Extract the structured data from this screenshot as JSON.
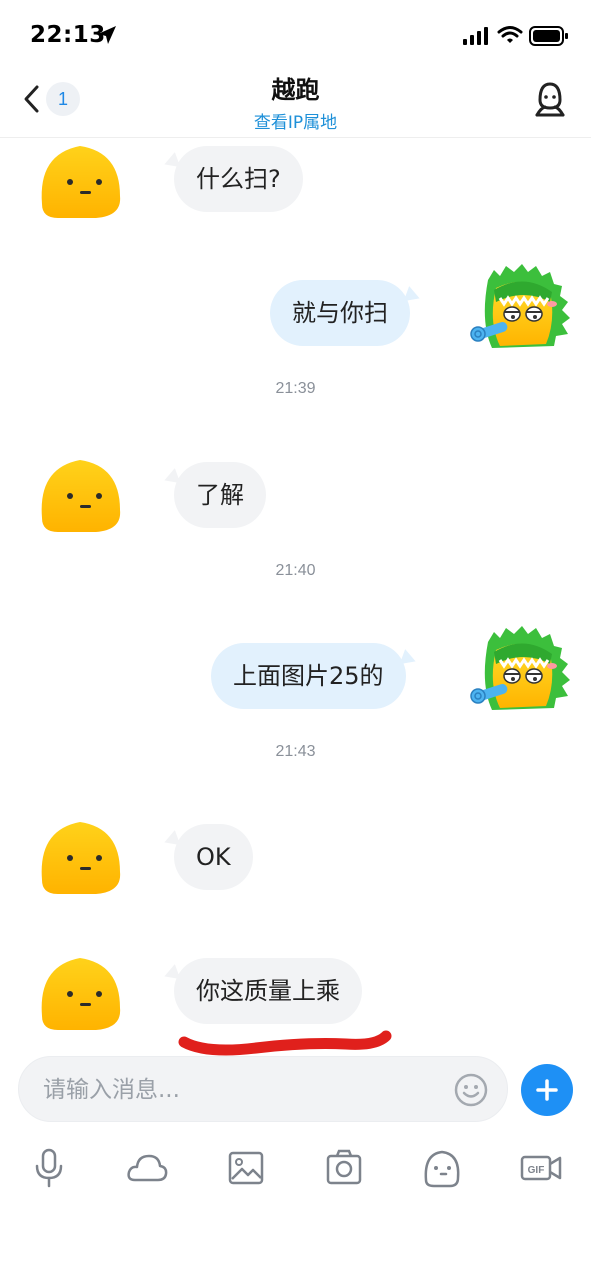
{
  "status_bar": {
    "time": "22:13"
  },
  "header": {
    "unread_count": "1",
    "title": "越跑",
    "subtitle_link": "查看IP属地"
  },
  "messages": [
    {
      "side": "in",
      "text": "什么扫?"
    },
    {
      "side": "out",
      "text": "就与你扫"
    },
    {
      "timestamp": "21:39"
    },
    {
      "side": "in",
      "text": "了解"
    },
    {
      "timestamp": "21:40"
    },
    {
      "side": "out",
      "text": "上面图片25的"
    },
    {
      "timestamp": "21:43"
    },
    {
      "side": "in",
      "text": "OK"
    },
    {
      "side": "in",
      "text": "你这质量上乘"
    }
  ],
  "input": {
    "placeholder": "请输入消息..."
  },
  "toolbar": {
    "items": [
      "microphone-icon",
      "cloud-icon",
      "image-icon",
      "camera-icon",
      "sticker-icon",
      "gif-icon"
    ]
  },
  "colors": {
    "accent": "#1e90f5",
    "incoming_bubble": "#f2f3f5",
    "outgoing_bubble": "#e2f1fd",
    "scribble": "#e0201c"
  }
}
